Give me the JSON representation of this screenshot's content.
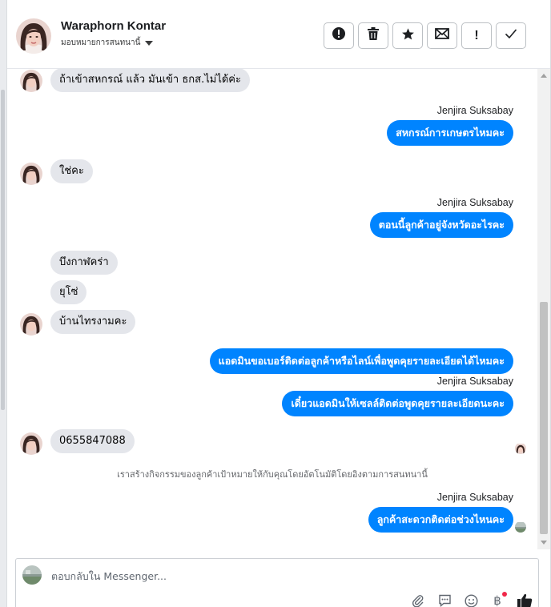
{
  "header": {
    "contact_name": "Waraphorn Kontar",
    "assign_label": "มอบหมายการสนทนานี้",
    "buttons": [
      {
        "name": "spam-button",
        "icon": "alert-circle-icon"
      },
      {
        "name": "delete-button",
        "icon": "trash-icon"
      },
      {
        "name": "star-button",
        "icon": "star-icon"
      },
      {
        "name": "mark-unread-button",
        "icon": "envelope-icon",
        "glyph": "✉"
      },
      {
        "name": "follow-up-button",
        "icon": "exclamation-icon",
        "glyph": "!"
      },
      {
        "name": "mark-done-button",
        "icon": "check-icon",
        "glyph": "✓"
      }
    ]
  },
  "conversation": {
    "messages": [
      {
        "direction": "in",
        "text": "ถ้าเข้าสหกรณ์ แล้ว มันเข้า ธกส.ไม่ได้ค่ะ"
      },
      {
        "direction": "out",
        "sender": "Jenjira Suksabay",
        "text": "สหกรณ์การเกษตรไหมคะ"
      },
      {
        "direction": "in",
        "text": "ใช่คะ"
      },
      {
        "direction": "out",
        "sender": "Jenjira Suksabay",
        "text": "ตอนนี้ลูกค้าอยู่จังหวัดอะไรคะ"
      },
      {
        "direction": "in",
        "text": "บึงกาฬคร่า"
      },
      {
        "direction": "in",
        "text": "ยุโซ่"
      },
      {
        "direction": "in",
        "text": "บ้านไทรงามคะ"
      },
      {
        "direction": "out",
        "text": "แอดมินขอเบอร์ติดต่อลูกค้าหรือไลน์เพื่อพูดคุยรายละเอียดได้ไหมคะ"
      },
      {
        "direction": "out",
        "sender": "Jenjira Suksabay",
        "text": "เดี๋ยวแอดมินให้เซลล์ติดต่อพูดคุยรายละเอียดนะคะ"
      },
      {
        "direction": "in",
        "text": "0655847088"
      },
      {
        "direction": "system",
        "text": "เราสร้างกิจกรรมของลูกค้าเป้าหมายให้กับคุณโดยอัตโนมัติโดยอิงตามการสนทนานี้"
      },
      {
        "direction": "out",
        "sender": "Jenjira Suksabay",
        "text": "ลูกค้าสะดวกติดต่อช่วงไหนคะ"
      }
    ]
  },
  "composer": {
    "placeholder": "ตอบกลับใน Messenger...",
    "tools": [
      "attachment-icon",
      "saved-reply-icon",
      "emoji-icon",
      "payment-icon",
      "like-icon"
    ],
    "payment_glyph": "฿"
  },
  "colors": {
    "outgoing_bubble": "#0084ff",
    "incoming_bubble": "#e4e6eb",
    "notification_dot": "#f02849"
  }
}
